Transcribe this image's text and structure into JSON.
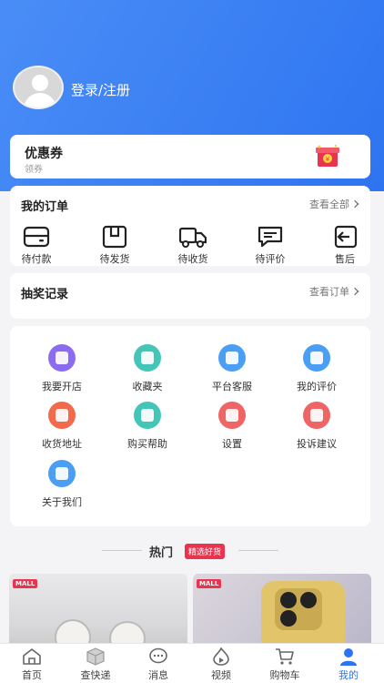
{
  "header": {
    "login_label": "登录/注册"
  },
  "coupon": {
    "title": "优惠券",
    "subtitle": "领券"
  },
  "orders": {
    "title": "我的订单",
    "view_all": "查看全部",
    "items": [
      {
        "label": "待付款",
        "icon": "wallet-icon"
      },
      {
        "label": "待发货",
        "icon": "box-icon"
      },
      {
        "label": "待收货",
        "icon": "truck-icon"
      },
      {
        "label": "待评价",
        "icon": "comment-icon"
      },
      {
        "label": "售后",
        "icon": "return-icon"
      }
    ]
  },
  "lottery": {
    "title": "抽奖记录",
    "view_orders": "查看订单"
  },
  "tools": [
    {
      "label": "我要开店",
      "icon": "shop-icon",
      "color": "#8b6cf0"
    },
    {
      "label": "收藏夹",
      "icon": "favorites-icon",
      "color": "#43c6b8"
    },
    {
      "label": "平台客服",
      "icon": "customer-service-icon",
      "color": "#4a9ff5"
    },
    {
      "label": "我的评价",
      "icon": "review-icon",
      "color": "#4a9ff5"
    },
    {
      "label": "收货地址",
      "icon": "location-icon",
      "color": "#f26a4b"
    },
    {
      "label": "购买帮助",
      "icon": "help-icon",
      "color": "#43c6b8"
    },
    {
      "label": "设置",
      "icon": "settings-icon",
      "color": "#ef6464"
    },
    {
      "label": "投诉建议",
      "icon": "warning-icon",
      "color": "#ef6464"
    },
    {
      "label": "关于我们",
      "icon": "info-icon",
      "color": "#4a9ff5"
    }
  ],
  "hot": {
    "title": "热门",
    "tag": "精选好货"
  },
  "products": [
    {
      "badge": "MALL"
    },
    {
      "badge": "MALL"
    }
  ],
  "tabbar": [
    {
      "label": "首页",
      "icon": "home-icon"
    },
    {
      "label": "查快递",
      "icon": "package-icon"
    },
    {
      "label": "消息",
      "icon": "message-icon"
    },
    {
      "label": "视频",
      "icon": "video-icon"
    },
    {
      "label": "购物车",
      "icon": "cart-icon"
    },
    {
      "label": "我的",
      "icon": "user-icon",
      "active": true
    }
  ],
  "colors": {
    "primary": "#2e74f0",
    "hot_tag": "#e8344e"
  }
}
